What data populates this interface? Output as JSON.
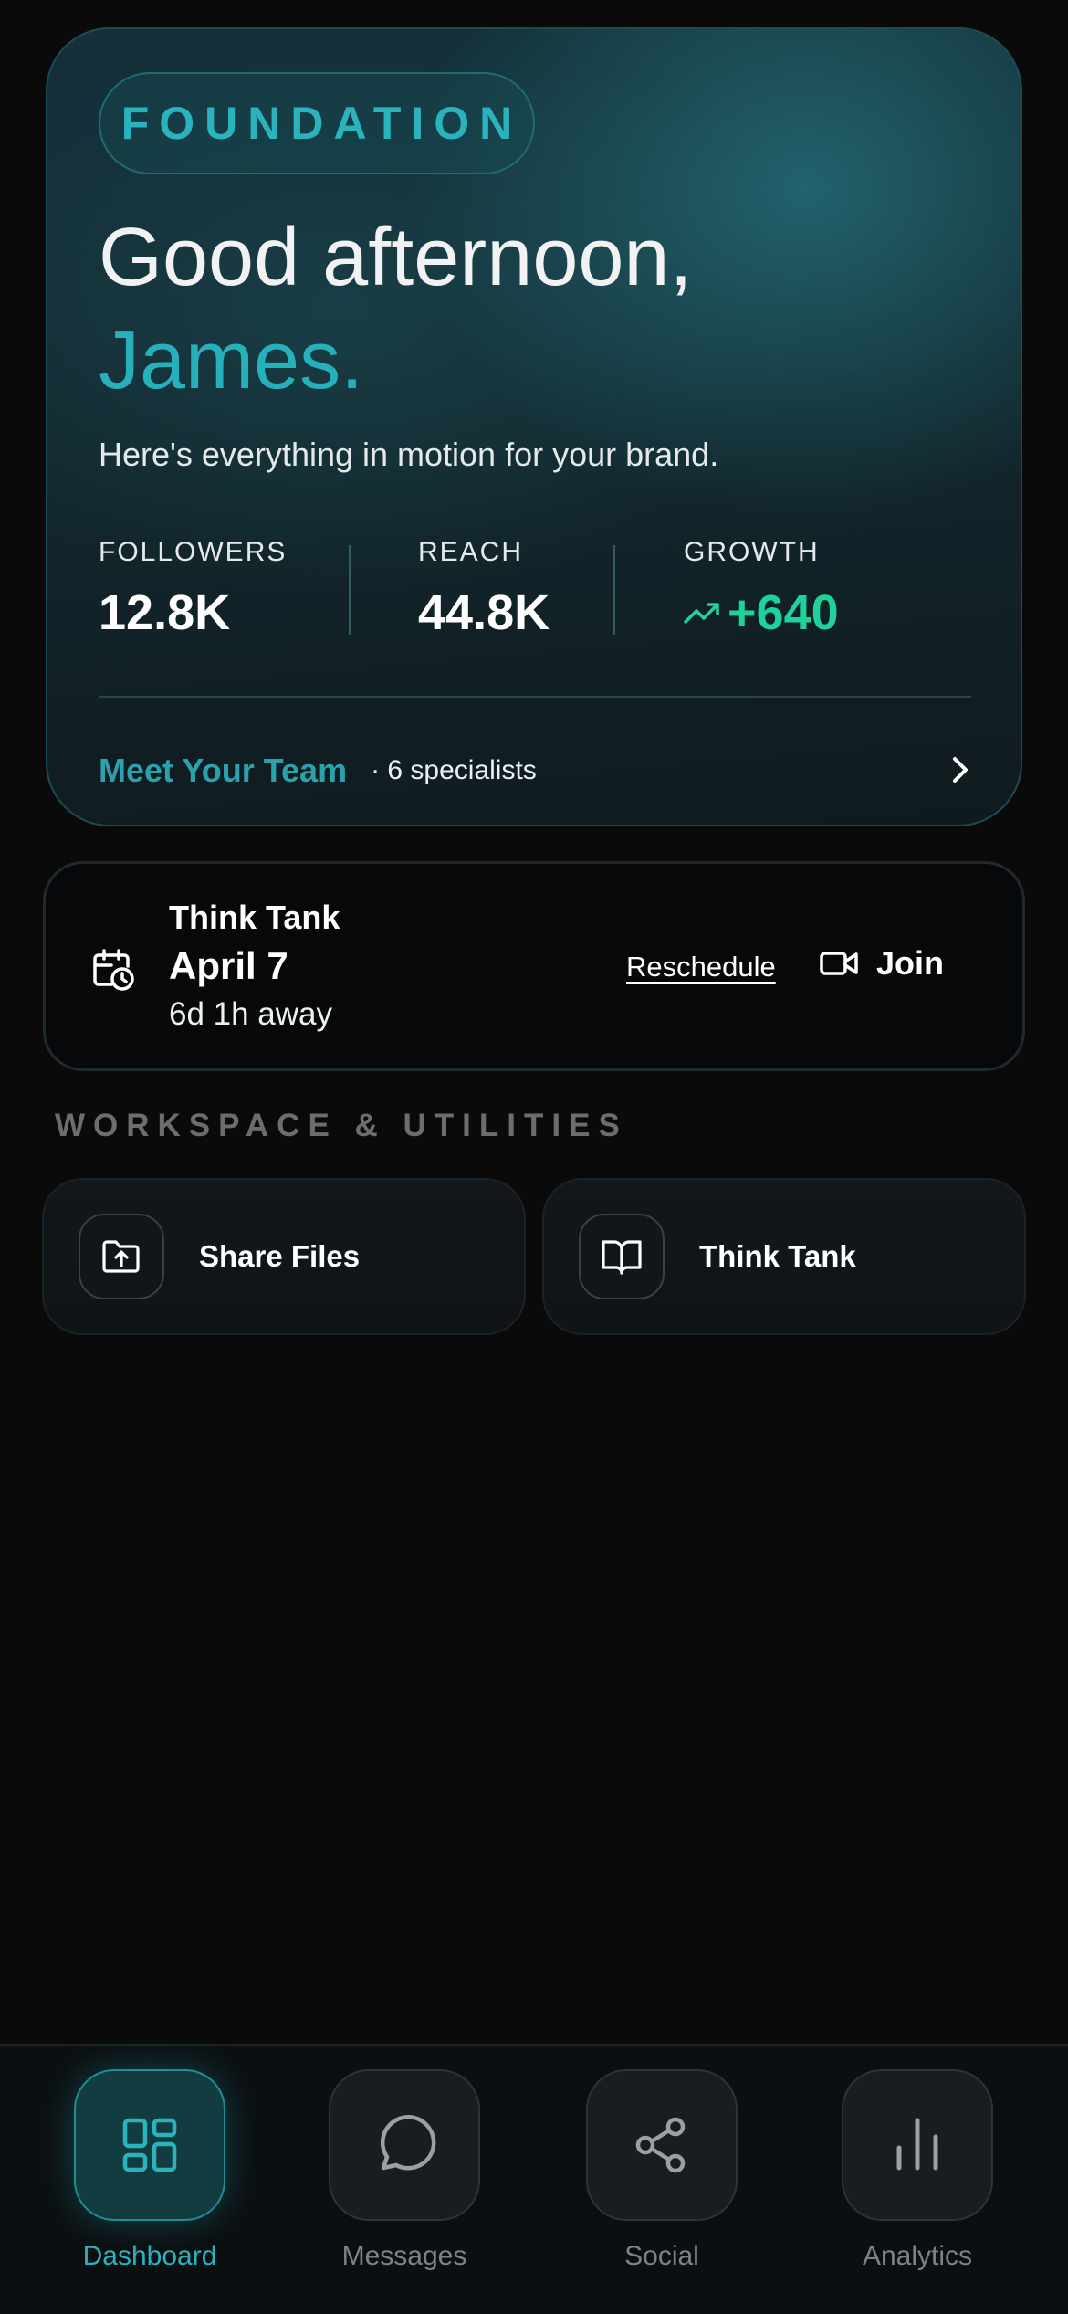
{
  "hero": {
    "badge": "FOUNDATION",
    "greeting": "Good afternoon,",
    "name": "James.",
    "subtitle": "Here's everything in motion for your brand.",
    "stats": [
      {
        "label": "FOLLOWERS",
        "value": "12.8K"
      },
      {
        "label": "REACH",
        "value": "44.8K"
      },
      {
        "label": "GROWTH",
        "value": "+640",
        "icon": "trending-up-icon"
      }
    ],
    "team_link": "Meet Your Team",
    "team_count": "· 6 specialists",
    "accent_color": "#2ab2bd",
    "growth_color": "#1fd29a"
  },
  "meeting": {
    "title": "Think Tank",
    "date": "April 7",
    "countdown": "6d 1h away",
    "reschedule_label": "Reschedule",
    "join_label": "Join",
    "icons": [
      "calendar-clock-icon",
      "video-camera-icon"
    ]
  },
  "workspace": {
    "heading": "WORKSPACE & UTILITIES",
    "tiles": [
      {
        "label": "Share Files",
        "icon": "folder-upload-icon"
      },
      {
        "label": "Think Tank",
        "icon": "open-book-icon"
      }
    ]
  },
  "nav": {
    "items": [
      {
        "label": "Dashboard",
        "icon": "dashboard-grid-icon",
        "active": true
      },
      {
        "label": "Messages",
        "icon": "chat-bubble-icon",
        "active": false
      },
      {
        "label": "Social",
        "icon": "share-nodes-icon",
        "active": false
      },
      {
        "label": "Analytics",
        "icon": "bar-chart-icon",
        "active": false
      }
    ]
  }
}
